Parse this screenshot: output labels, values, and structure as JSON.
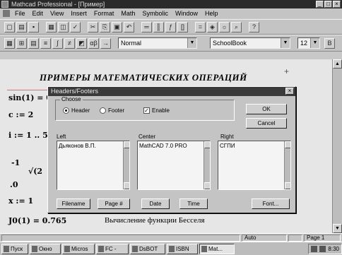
{
  "window": {
    "title": "Mathcad Professional - [Пример]"
  },
  "menu": [
    "File",
    "Edit",
    "View",
    "Insert",
    "Format",
    "Math",
    "Symbolic",
    "Window",
    "Help"
  ],
  "format_toolbar": {
    "style": "Normal",
    "font": "SchoolBook",
    "size": "12"
  },
  "document": {
    "title": "ПРИМЕРЫ МАТЕМАТИЧЕСКИХ ОПЕРАЦИЙ",
    "lines": [
      {
        "text": "sin(1) = 0"
      },
      {
        "text": "c := 2"
      },
      {
        "text": "i := 1 .. 5"
      },
      {
        "text": "-1"
      },
      {
        "text": "√(2"
      },
      {
        "text": ".0"
      },
      {
        "text": "x := 1"
      },
      {
        "text": "J0(1) = 0.765"
      }
    ],
    "comment": "Вычисление функции Бесселя"
  },
  "dialog": {
    "title": "Headers/Footers",
    "choose_label": "Choose",
    "options": {
      "header": "Header",
      "footer": "Footer",
      "enable": "Enable"
    },
    "buttons": {
      "ok": "OK",
      "cancel": "Cancel",
      "filename": "Filename",
      "page": "Page #",
      "date": "Date",
      "time": "Time",
      "font": "Font..."
    },
    "fields": {
      "left_label": "Left",
      "left_value": "Дьяконов В.П.",
      "center_label": "Center",
      "center_value": "MathCAD 7.0 PRO",
      "right_label": "Right",
      "right_value": "СГПИ"
    }
  },
  "status": {
    "mode": "Auto",
    "page": "Page 1"
  },
  "taskbar": {
    "start": "Пуск",
    "tasks": [
      "Окно",
      "Micros",
      "FC -",
      "DsBOT",
      "ISBN",
      "Mat..."
    ],
    "clock": "8:30"
  }
}
